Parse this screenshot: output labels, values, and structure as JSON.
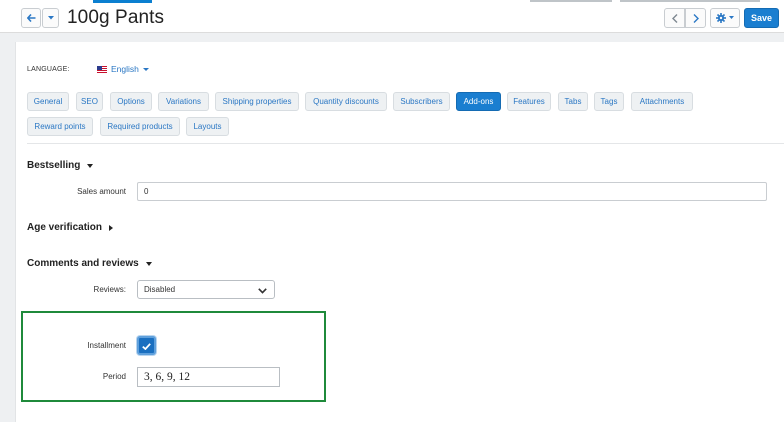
{
  "header": {
    "title": "100g Pants",
    "save_label": "Save",
    "icons": {
      "back": "arrow-left-icon",
      "dropdown": "caret-down-icon",
      "prev": "chevron-left-icon",
      "next": "chevron-right-icon",
      "settings": "gear-icon"
    }
  },
  "language": {
    "label": "LANGUAGE:",
    "selected": "English",
    "flag": "us-flag-icon"
  },
  "tabs": [
    {
      "label": "General"
    },
    {
      "label": "SEO"
    },
    {
      "label": "Options"
    },
    {
      "label": "Variations"
    },
    {
      "label": "Shipping properties"
    },
    {
      "label": "Quantity discounts"
    },
    {
      "label": "Subscribers"
    },
    {
      "label": "Add-ons",
      "active": true
    },
    {
      "label": "Features"
    },
    {
      "label": "Tabs"
    },
    {
      "label": "Tags"
    },
    {
      "label": "Attachments"
    },
    {
      "label": "Reward points"
    },
    {
      "label": "Required products"
    },
    {
      "label": "Layouts"
    }
  ],
  "sections": {
    "bestselling": {
      "title": "Bestselling",
      "sales_amount_label": "Sales amount",
      "sales_amount_value": "0"
    },
    "age_verification": {
      "title": "Age verification"
    },
    "comments": {
      "title": "Comments and reviews",
      "reviews_label": "Reviews:",
      "reviews_value": "Disabled"
    },
    "installment": {
      "installment_label": "Installment",
      "installment_checked": true,
      "period_label": "Period",
      "period_value": "3, 6, 9, 12"
    }
  },
  "colors": {
    "accent": "#1a7ed0",
    "link": "#2a77c4",
    "highlight_border": "#1f8a3b"
  }
}
